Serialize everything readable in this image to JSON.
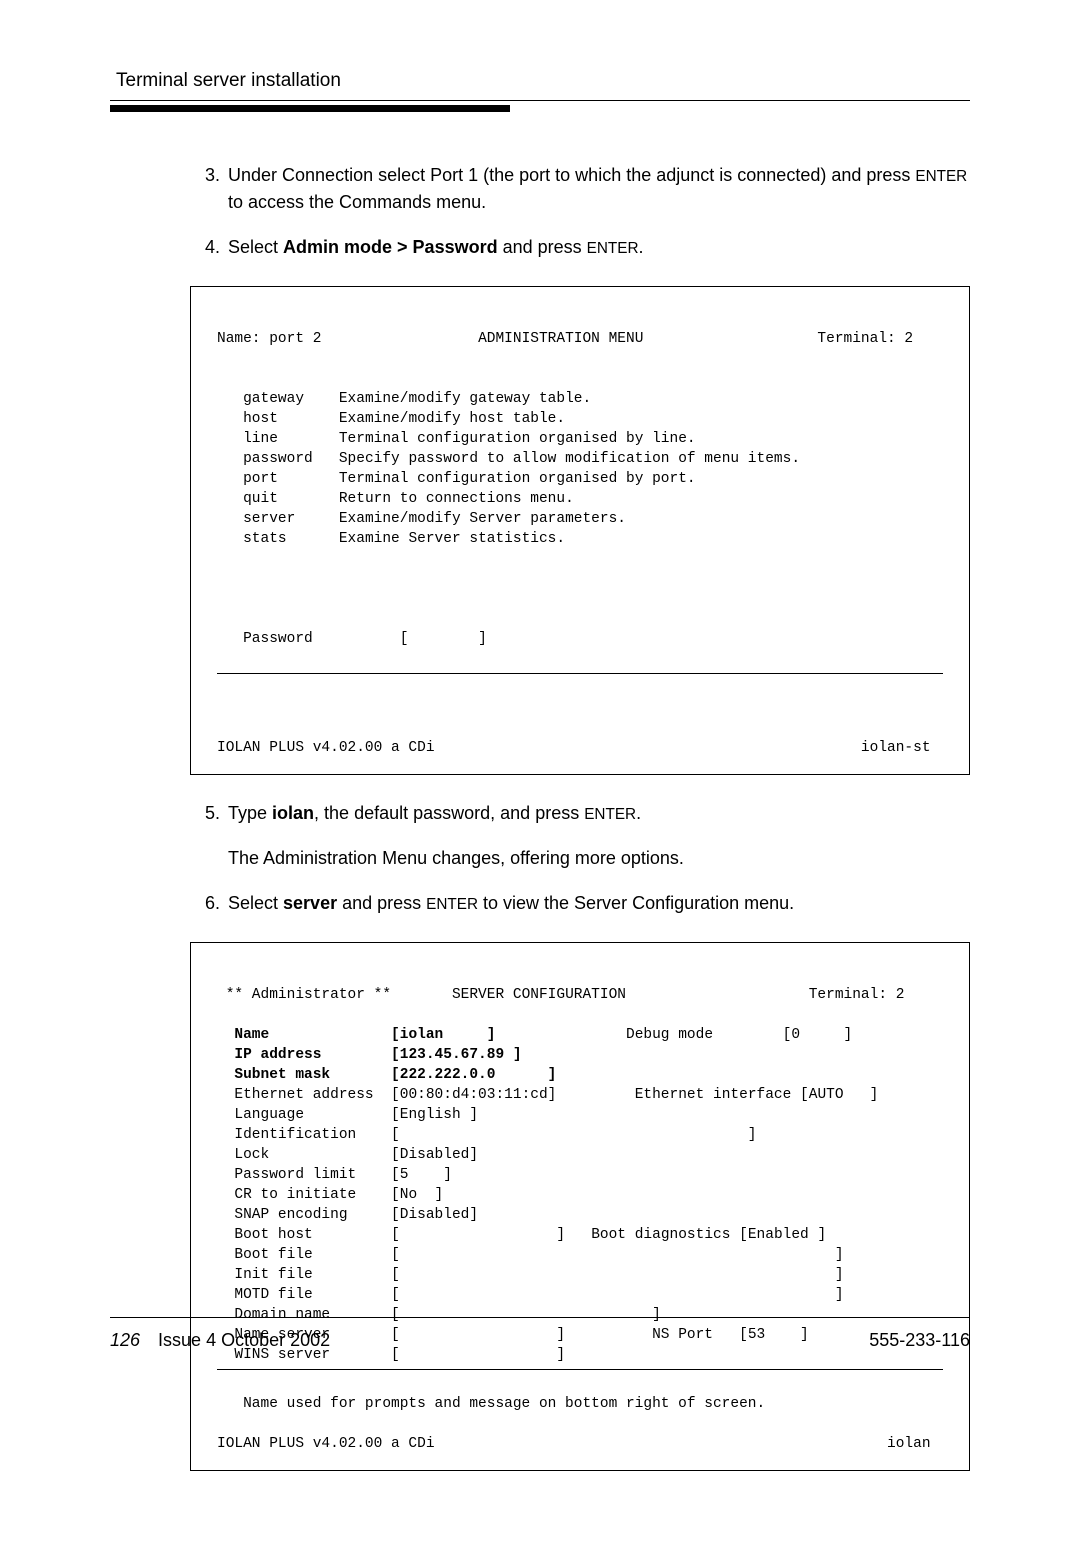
{
  "header": {
    "title": "Terminal server installation"
  },
  "steps": {
    "s3": {
      "num": "3.",
      "text_before": "Under Connection select Port 1 (the port to which the adjunct is connected) and press ",
      "enter": "ENTER",
      "text_after": " to access the Commands menu."
    },
    "s4": {
      "num": "4.",
      "text_before": "Select ",
      "bold": "Admin mode > Password",
      "text_mid": " and press ",
      "enter": "ENTER",
      "text_after": "."
    },
    "s5": {
      "num": "5.",
      "text_before": "Type ",
      "bold": "iolan",
      "text_mid": ", the default password, and press ",
      "enter": "ENTER",
      "text_after": "."
    },
    "s5sub": "The Administration Menu changes, offering more options.",
    "s6": {
      "num": "6.",
      "text_before": "Select ",
      "bold": "server",
      "text_mid": " and press ",
      "enter": "ENTER",
      "text_after": " to view the Server Configuration menu."
    }
  },
  "terminal1": {
    "header_left": "Name: port 2",
    "header_center": "ADMINISTRATION MENU",
    "header_right": "Terminal: 2",
    "items": [
      {
        "cmd": "gateway ",
        "desc": "Examine/modify gateway table."
      },
      {
        "cmd": "host    ",
        "desc": "Examine/modify host table."
      },
      {
        "cmd": "line    ",
        "desc": "Terminal configuration organised by line."
      },
      {
        "cmd": "password",
        "desc": "Specify password to allow modification of menu items."
      },
      {
        "cmd": "port    ",
        "desc": "Terminal configuration organised by port."
      },
      {
        "cmd": "quit    ",
        "desc": "Return to connections menu."
      },
      {
        "cmd": "server  ",
        "desc": "Examine/modify Server parameters."
      },
      {
        "cmd": "stats   ",
        "desc": "Examine Server statistics."
      }
    ],
    "password_label": "Password",
    "password_field": "[        ]",
    "footer_left": "IOLAN PLUS v4.02.00 a CDi",
    "footer_right": "iolan-st"
  },
  "terminal2": {
    "header_left": "** Administrator **",
    "header_center": "SERVER CONFIGURATION",
    "header_right": "Terminal: 2",
    "rows": {
      "name_label": "Name",
      "name_val": "[iolan     ]",
      "debug_label": "Debug mode",
      "debug_val": "[0     ]",
      "ip_label": "IP address",
      "ip_val": "[123.45.67.89 ]",
      "subnet_label": "Subnet mask",
      "subnet_val": "[222.222.0.0      ]",
      "eth_addr_label": "Ethernet address",
      "eth_addr_val": "[00:80:d4:03:11:cd]",
      "eth_if_label": "Ethernet interface",
      "eth_if_val": "[AUTO   ]",
      "lang_label": "Language",
      "lang_val": "[English ]",
      "ident_label": "Identification",
      "ident_val": "[                                        ]",
      "lock_label": "Lock",
      "lock_val": "[Disabled]",
      "pwlimit_label": "Password limit",
      "pwlimit_val": "[5    ]",
      "cr_label": "CR to initiate",
      "cr_val": "[No  ]",
      "snap_label": "SNAP encoding",
      "snap_val": "[Disabled]",
      "boothost_label": "Boot host",
      "boothost_val": "[                  ]",
      "bootdiag_label": "Boot diagnostics",
      "bootdiag_val": "[Enabled ]",
      "bootfile_label": "Boot file",
      "bootfile_val": "[                                                  ]",
      "initfile_label": "Init file",
      "initfile_val": "[                                                  ]",
      "motd_label": "MOTD file",
      "motd_val": "[                                                  ]",
      "domain_label": "Domain name",
      "domain_val": "[                             ]",
      "ns_label": "Name server",
      "ns_val": "[                  ]",
      "nsport_label": "NS Port",
      "nsport_val": "[53    ]",
      "wins_label": "WINS server",
      "wins_val": "[                  ]"
    },
    "help_text": "Name used for prompts and message on bottom right of screen.",
    "footer_left": "IOLAN PLUS v4.02.00 a CDi",
    "footer_right": "iolan"
  },
  "footer": {
    "page_num": "126",
    "issue": "Issue 4  October 2002",
    "doc_num": "555-233-116"
  }
}
